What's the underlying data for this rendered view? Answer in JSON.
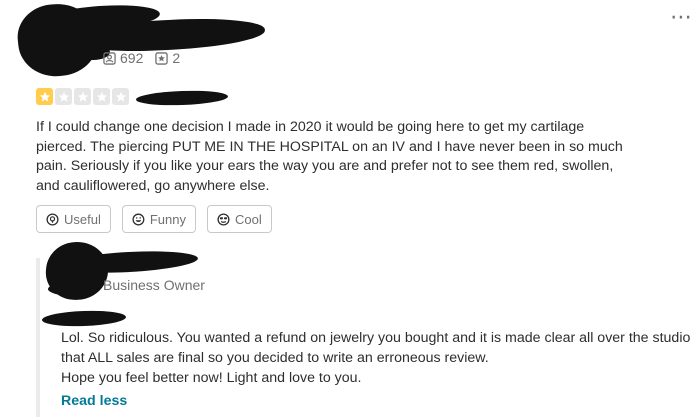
{
  "reviewer": {
    "friends_count": "692",
    "reviews_count": "2",
    "friends_icon": "friends-icon",
    "reviews_icon": "reviews-icon"
  },
  "review": {
    "rating": 1,
    "max_rating": 5,
    "star_color": "#ffcc4b",
    "empty_star_color": "#e6e6e6",
    "lines": [
      "If I could change one decision I made in 2020 it would be going here to get my cartilage",
      "pierced. The piercing PUT ME IN THE HOSPITAL on an IV and I have never been in so much",
      "pain. Seriously if you like your ears the way you are and prefer not to see them red, swollen,",
      "and cauliflowered, go anywhere else."
    ]
  },
  "reactions": {
    "useful_label": "Useful",
    "funny_label": "Funny",
    "cool_label": "Cool"
  },
  "owner_reply": {
    "role": "Business Owner",
    "lines": [
      "Lol. So ridiculous. You wanted a refund on jewelry you bought and it is made clear all over the studio",
      "that ALL sales are final so you decided to write an erroneous review.",
      "Hope you feel better now! Light and love to you."
    ],
    "read_less_label": "Read less",
    "link_color": "#027a97"
  },
  "menu": {
    "more_icon": "⋯"
  }
}
